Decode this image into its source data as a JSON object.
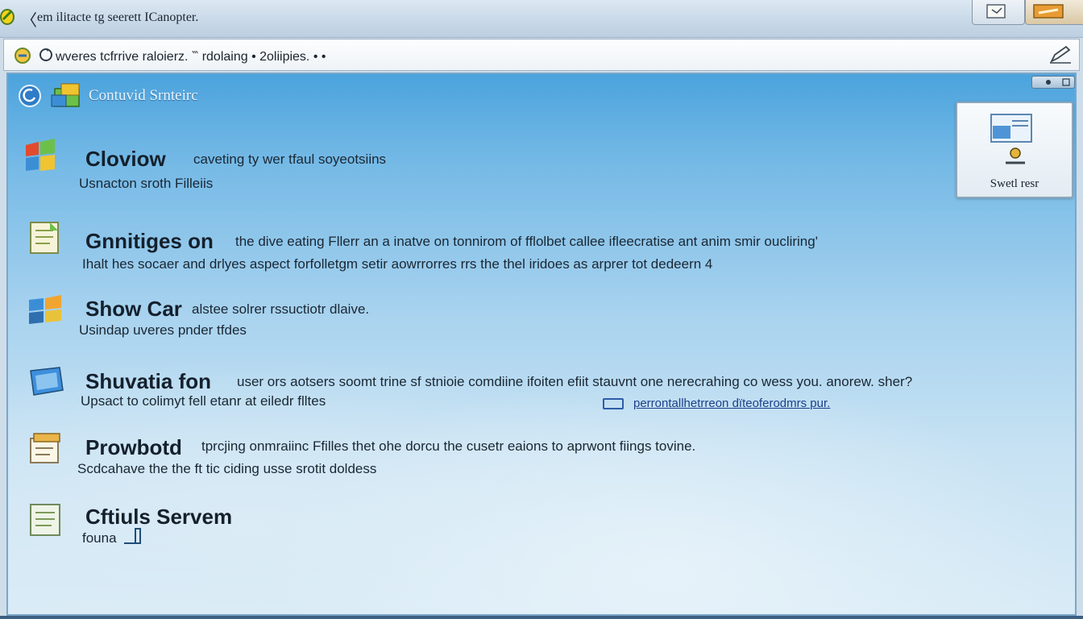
{
  "window": {
    "title": "em ilitacte tg seerett ICanopter.",
    "title_caret": "〈"
  },
  "addressbar": {
    "path": "wveres tcfrrive raloierz. ‷ rdolaing  •  2oliipies.  • •"
  },
  "panel": {
    "title": "Contuvid Srnteirc",
    "side_card": {
      "label": "Swetl resr"
    }
  },
  "items": [
    {
      "icon": "windows-flag-icon",
      "title": "Cloviow",
      "description": "caveting ty wer tfaul soyeotsiins",
      "subtitle": "Usnacton sroth Filleiis"
    },
    {
      "icon": "document-icon",
      "title": "Gnnitiges on",
      "description": "the dive eating Fllerr an a inatve on tonnirom of fflolbet callee ifleecratise ant anim smir oucliring'",
      "subtitle": "Ihalt hes socaer and drlyes aspect forfolletgm setir aowrrorres rrs the thel iridoes as arprer tot dedeern  4"
    },
    {
      "icon": "windows-flag-icon",
      "title": "Show Car",
      "description": "alstee solrer rssuctiotr dlaive.",
      "subtitle": "Usindap uveres pnder tfdes"
    },
    {
      "icon": "folder-icon",
      "title": "Shuvatia fon",
      "description": "user ors aotsers soomt trine sf stnioie comdiine ifoiten efiit stauvnt one nerecrahing co wess you. anorew. sher?",
      "subtitle": "Upsact to colimyt fell etanr at eiledr flltes",
      "link": "perrontallhetrreon dïteoferodmrs pur."
    },
    {
      "icon": "notepad-icon",
      "title": "Prowbotd",
      "description": "tprcjing onmraiinc Ffilles thet ohe dorcu the cusetr eaions to aprwont fiings tovine.",
      "subtitle": "Scdcahave the the  ft tic ciding usse srotit doldess"
    },
    {
      "icon": "clipboard-icon",
      "title": "Cftiuls Servem",
      "description": "",
      "subtitle": "founa"
    }
  ],
  "colors": {
    "panel_top": "#4ba3dd",
    "panel_bottom": "#d9ebf6",
    "title_text": "#14202c",
    "link": "#1d3f8a"
  }
}
